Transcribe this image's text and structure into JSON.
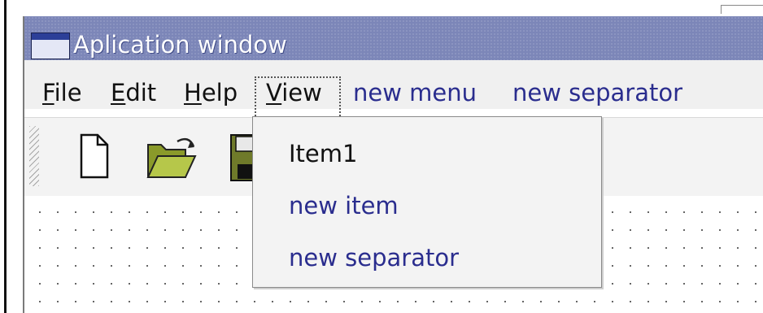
{
  "window": {
    "title": "Aplication window"
  },
  "menubar": {
    "items": [
      {
        "accel": "F",
        "rest": "ile"
      },
      {
        "accel": "E",
        "rest": "dit"
      },
      {
        "accel": "H",
        "rest": "elp"
      },
      {
        "accel": "V",
        "rest": "iew"
      },
      {
        "label": "new menu"
      },
      {
        "label": "new separator"
      }
    ]
  },
  "toolbar": {
    "buttons": [
      {
        "icon": "new-document-icon"
      },
      {
        "icon": "open-folder-icon"
      },
      {
        "icon": "save-disk-icon"
      }
    ]
  },
  "dropdown": {
    "items": [
      {
        "label": "Item1"
      },
      {
        "label": "new item"
      },
      {
        "label": "new separator"
      }
    ]
  },
  "colors": {
    "titlebar": "#7c86b8",
    "menu_placeholder_text": "#2a2d8e"
  }
}
